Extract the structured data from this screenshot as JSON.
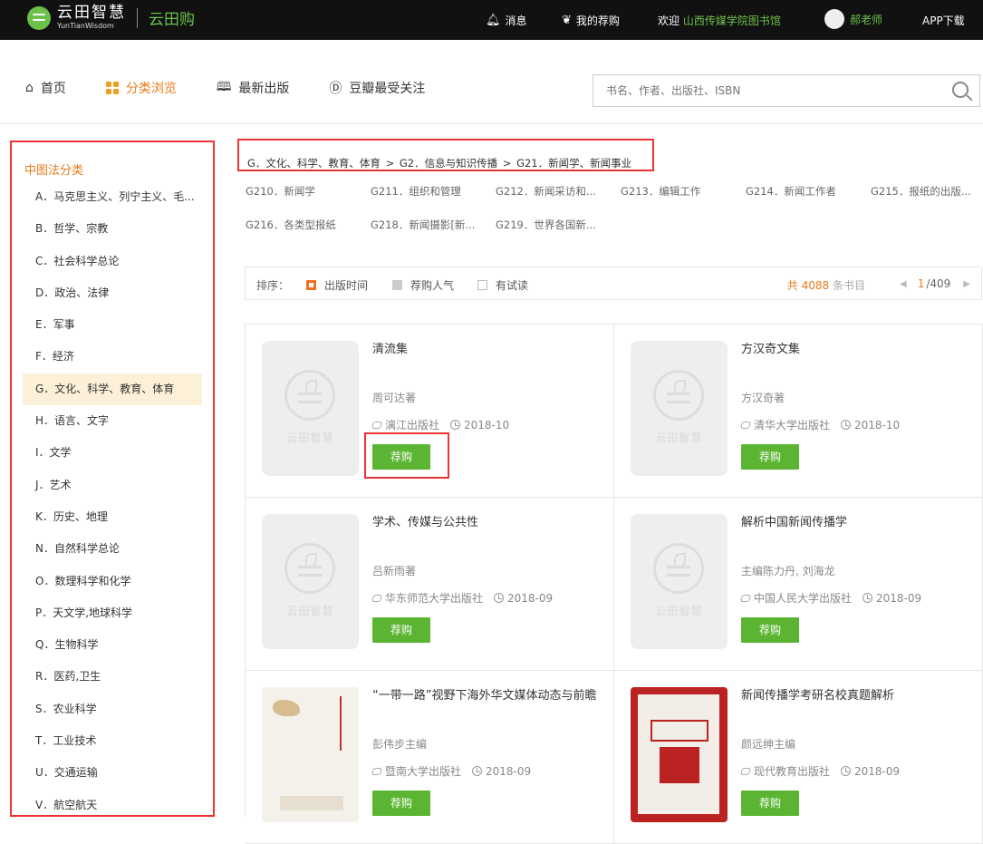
{
  "header": {
    "logo_cn": "云田智慧",
    "logo_en": "YunTianWisdom",
    "sub_brand": "云田购",
    "messages": "消息",
    "my_recommend": "我的荐购",
    "welcome": "欢迎",
    "library": "山西传媒学院图书馆",
    "user": "郝老师",
    "app_download": "APP下载"
  },
  "nav": {
    "home": "首页",
    "browse": "分类浏览",
    "new": "最新出版",
    "douban": "豆瓣最受关注",
    "search_placeholder": "书名、作者、出版社、ISBN"
  },
  "sidebar": {
    "title": "中图法分类",
    "items": [
      "A．马克思主义、列宁主义、毛...",
      "B．哲学、宗教",
      "C．社会科学总论",
      "D．政治、法律",
      "E．军事",
      "F．经济",
      "G．文化、科学、教育、体育",
      "H．语言、文字",
      "I．文学",
      "J．艺术",
      "K．历史、地理",
      "N．自然科学总论",
      "O．数理科学和化学",
      "P．天文学,地球科学",
      "Q．生物科学",
      "R．医药,卫生",
      "S．农业科学",
      "T．工业技术",
      "U．交通运输",
      "V．航空航天"
    ]
  },
  "breadcrumb": {
    "l1": "G．文化、科学、教育、体育",
    "l2": "G2．信息与知识传播",
    "l3": "G21．新闻学、新闻事业",
    "sep": ">"
  },
  "subcats": [
    "G210．新闻学",
    "G211．组织和管理",
    "G212．新闻采访和...",
    "G213．编辑工作",
    "G214．新闻工作者",
    "G215．报纸的出版...",
    "G216．各类型报纸",
    "G218．新闻摄影[新...",
    "G219．世界各国新..."
  ],
  "sort": {
    "label": "排序：",
    "by_date": "出版时间",
    "by_popularity": "荐购人气",
    "has_trial": "有试读",
    "total_prefix": "共",
    "total": "4088",
    "total_suffix": "条书目",
    "page_current": "1",
    "page_total": "/409"
  },
  "books": [
    {
      "title": "清流集",
      "author": "周可达著",
      "publisher": "漓江出版社",
      "date": "2018-10",
      "buy": "荐购",
      "cover_brand": "云田智慧"
    },
    {
      "title": "方汉奇文集",
      "author": "方汉奇著",
      "publisher": "清华大学出版社",
      "date": "2018-10",
      "buy": "荐购",
      "cover_brand": "云田智慧"
    },
    {
      "title": "学术、传媒与公共性",
      "author": "吕新雨著",
      "publisher": "华东师范大学出版社",
      "date": "2018-09",
      "buy": "荐购",
      "cover_brand": "云田智慧"
    },
    {
      "title": "解析中国新闻传播学",
      "author": "主编陈力丹, 刘海龙",
      "publisher": "中国人民大学出版社",
      "date": "2018-09",
      "buy": "荐购",
      "cover_brand": "云田智慧"
    },
    {
      "title": "“一带一路”视野下海外华文媒体动态与前瞻",
      "author": "彭伟步主编",
      "publisher": "暨南大学出版社",
      "date": "2018-09",
      "buy": "荐购"
    },
    {
      "title": "新闻传播学考研名校真题解析",
      "author": "颜远绅主编",
      "publisher": "现代教育出版社",
      "date": "2018-09",
      "buy": "荐购"
    }
  ],
  "colors": {
    "accent": "#e87b1c",
    "green": "#5cb532",
    "highlight": "#ee3333"
  }
}
